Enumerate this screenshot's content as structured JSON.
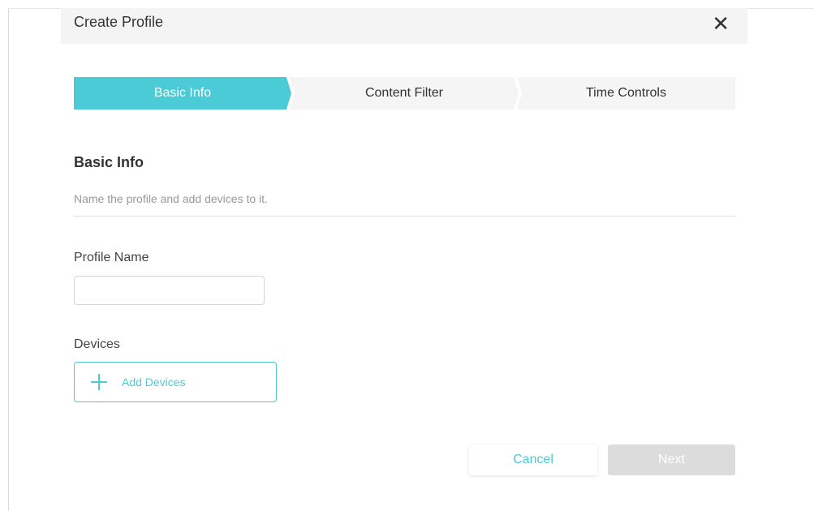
{
  "dialog": {
    "title": "Create Profile",
    "close_symbol": "✕"
  },
  "stepper": {
    "steps": [
      {
        "label": "Basic Info",
        "active": true
      },
      {
        "label": "Content Filter",
        "active": false
      },
      {
        "label": "Time Controls",
        "active": false
      }
    ]
  },
  "section": {
    "title": "Basic Info",
    "description": "Name the profile and add devices to it."
  },
  "fields": {
    "profile_name": {
      "label": "Profile Name",
      "value": "",
      "placeholder": ""
    },
    "devices": {
      "label": "Devices",
      "add_button_label": "Add Devices",
      "add_icon": "plus-icon"
    }
  },
  "footer": {
    "cancel_label": "Cancel",
    "next_label": "Next"
  },
  "colors": {
    "accent": "#4acbd6",
    "disabled": "#dcdcdc",
    "header_bg": "#f4f4f4"
  }
}
